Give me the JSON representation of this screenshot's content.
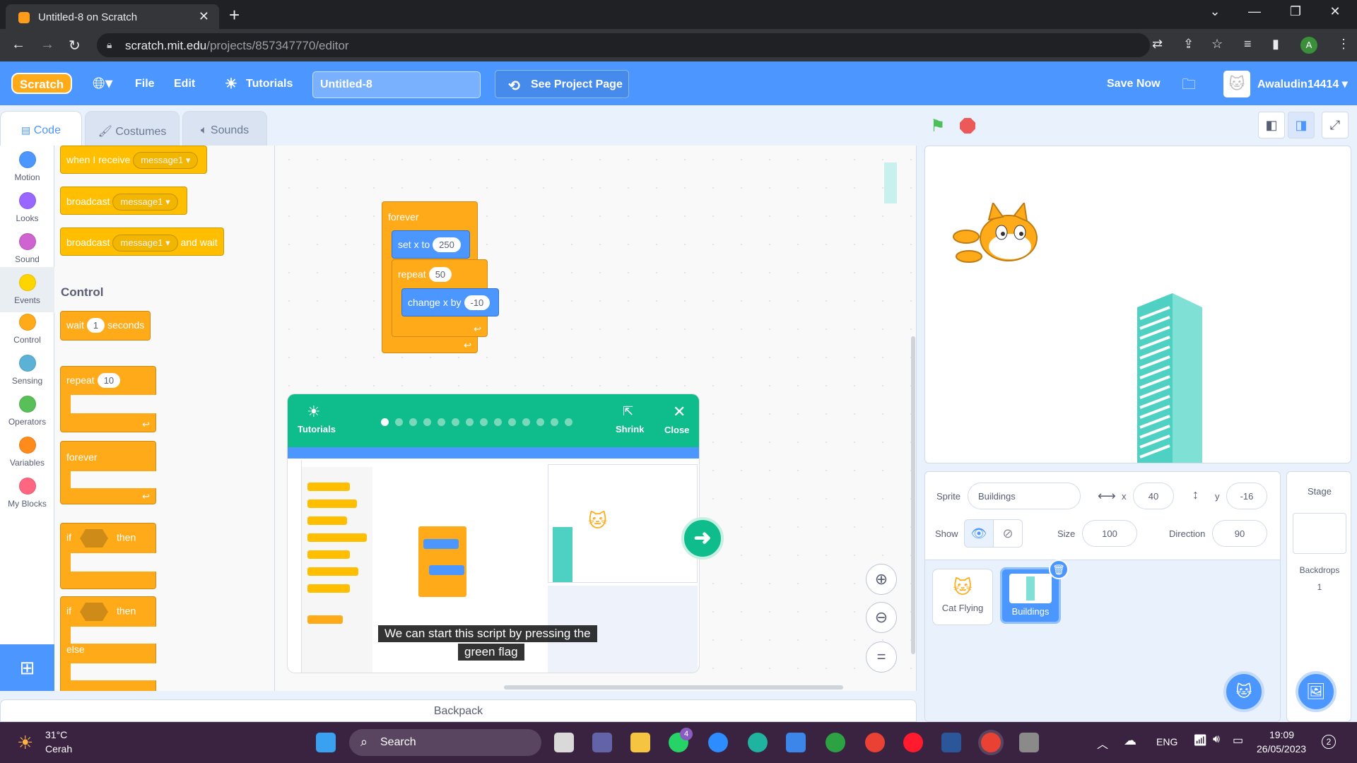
{
  "browser": {
    "tab_title": "Untitled-8 on Scratch",
    "url_host": "scratch.mit.edu",
    "url_path": "/projects/857347770/editor",
    "profile_initial": "A"
  },
  "menubar": {
    "logo": "Scratch",
    "file": "File",
    "edit": "Edit",
    "tutorials": "Tutorials",
    "project_title": "Untitled-8",
    "see_project": "See Project Page",
    "save_now": "Save Now",
    "username": "Awaludin14414"
  },
  "tabs": {
    "code": "Code",
    "costumes": "Costumes",
    "sounds": "Sounds"
  },
  "categories": [
    {
      "label": "Motion",
      "color": "#4c97ff"
    },
    {
      "label": "Looks",
      "color": "#9966ff"
    },
    {
      "label": "Sound",
      "color": "#cf63cf"
    },
    {
      "label": "Events",
      "color": "#ffd500"
    },
    {
      "label": "Control",
      "color": "#ffab19"
    },
    {
      "label": "Sensing",
      "color": "#5cb1d6"
    },
    {
      "label": "Operators",
      "color": "#59c059"
    },
    {
      "label": "Variables",
      "color": "#ff8c1a"
    },
    {
      "label": "My Blocks",
      "color": "#ff6680"
    }
  ],
  "palette": {
    "when_receive": "when I receive",
    "message1": "message1",
    "broadcast": "broadcast",
    "and_wait": "and wait",
    "control_title": "Control",
    "wait": "wait",
    "wait_val": "1",
    "seconds": "seconds",
    "repeat": "repeat",
    "repeat_val": "10",
    "forever": "forever",
    "if": "if",
    "then": "then",
    "else": "else"
  },
  "script": {
    "forever": "forever",
    "set_x": "set x to",
    "set_x_val": "250",
    "repeat": "repeat",
    "repeat_val": "50",
    "change_x": "change x by",
    "change_x_val": "-10"
  },
  "tutorial": {
    "label": "Tutorials",
    "shrink": "Shrink",
    "close": "Close",
    "caption_line1": "We can start this script by pressing the",
    "caption_line2": "green flag",
    "steps_total": 14,
    "step_current": 1
  },
  "backpack": "Backpack",
  "sprite_info": {
    "sprite_label": "Sprite",
    "sprite_name": "Buildings",
    "x_label": "x",
    "x_val": "40",
    "y_label": "y",
    "y_val": "-16",
    "show_label": "Show",
    "size_label": "Size",
    "size_val": "100",
    "direction_label": "Direction",
    "direction_val": "90"
  },
  "sprites": [
    {
      "name": "Cat Flying",
      "selected": false
    },
    {
      "name": "Buildings",
      "selected": true
    }
  ],
  "stage_pane": {
    "title": "Stage",
    "backdrops_label": "Backdrops",
    "backdrops_count": "1"
  },
  "taskbar": {
    "temp": "31°C",
    "weather": "Cerah",
    "search": "Search",
    "whatsapp_badge": "4",
    "lang": "ENG",
    "time": "19:09",
    "date": "26/05/2023",
    "notif": "2"
  }
}
